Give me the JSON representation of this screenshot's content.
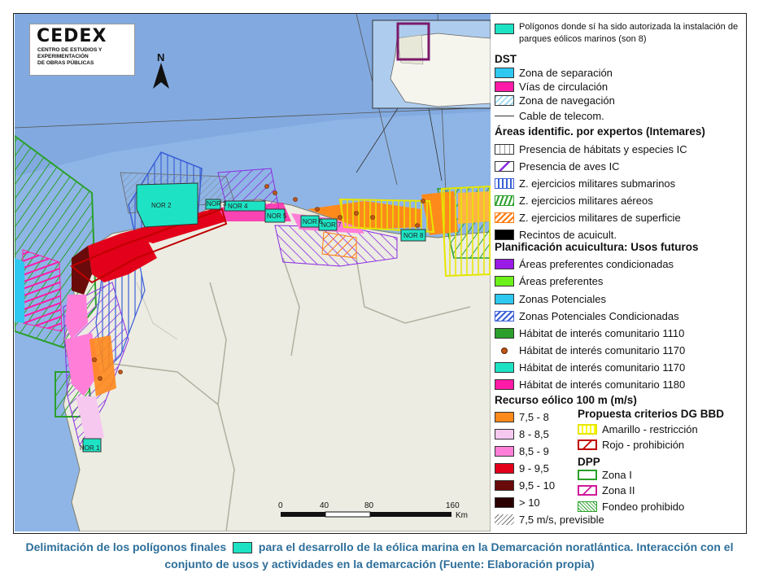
{
  "logo": {
    "name": "CEDEX",
    "subtitle_lines": [
      "CENTRO DE ESTUDIOS Y",
      "EXPERIMENTACIÓN",
      "DE OBRAS PÚBLICAS"
    ]
  },
  "north_label": "N",
  "map_labels": [
    "NOR 2",
    "NOR 3",
    "NOR 4",
    "NOR 5",
    "NOR 6",
    "NOR 7",
    "NOR 8",
    "NOR 1"
  ],
  "scale_bar": {
    "ticks": [
      "0",
      "40",
      "80",
      "160"
    ],
    "unit": "Km"
  },
  "legend": {
    "top_item": "Polígonos donde sí ha sido autorizada la instalación de parques eólicos marinos (son 8)",
    "dst": {
      "title": "DST",
      "items": [
        "Zona de separación",
        "Vías de circulación",
        "Zona de navegación",
        "Cable de telecom."
      ]
    },
    "expertos": {
      "title": "Áreas identific. por expertos (Intemares)",
      "items": [
        "Presencia de hábitats y especies IC",
        "Presencia de aves IC",
        "Z. ejercicios militares submarinos",
        "Z. ejercicios militares aéreos",
        "Z. ejercicios militares de superficie",
        "Recintos de acuicult."
      ]
    },
    "acuicultura": {
      "title": "Planificación acuicultura: Usos futuros",
      "items": [
        "Áreas preferentes condicionadas",
        "Áreas preferentes",
        "Zonas Potenciales",
        "Zonas Potenciales Condicionadas",
        "Hábitat de interés comunitario 1110",
        "Hábitat de interés comunitario 1170",
        "Hábitat de interés comunitario 1170",
        "Hábitat de interés comunitario 1180"
      ]
    },
    "recurso": {
      "title": "Recurso eólico 100 m (m/s)",
      "items": [
        "7,5 - 8",
        "8 - 8,5",
        "8,5 - 9",
        "9 - 9,5",
        "9,5 - 10",
        "> 10",
        "7,5 m/s, previsible"
      ]
    },
    "propuesta": {
      "title": "Propuesta criterios DG BBD",
      "items": [
        "Amarillo - restricción",
        "Rojo - prohibición"
      ]
    },
    "dpp": {
      "title": "DPP",
      "items": [
        "Zona I",
        "Zona II",
        "Fondeo prohibido"
      ]
    }
  },
  "caption": {
    "part1": "Delimitación de los polígonos finales",
    "part2": "para el desarrollo de la eólica marina en la Demarcación noratlántica. Interacción con el conjunto de usos y actividades en la demarcación (Fuente: Elaboración propia)"
  },
  "colors": {
    "polygon_teal": "#1de3c4",
    "sea": "#8fb5e6",
    "land": "#ecece2",
    "orange": "#ff8a1c",
    "red": "#e2001a",
    "pink": "#ff7fd8",
    "magenta": "#ff1aa8",
    "purple": "#9a1ae6",
    "blue_hatch": "#3b5fd6",
    "green": "#2aa02a",
    "yellow": "#ffff00"
  }
}
